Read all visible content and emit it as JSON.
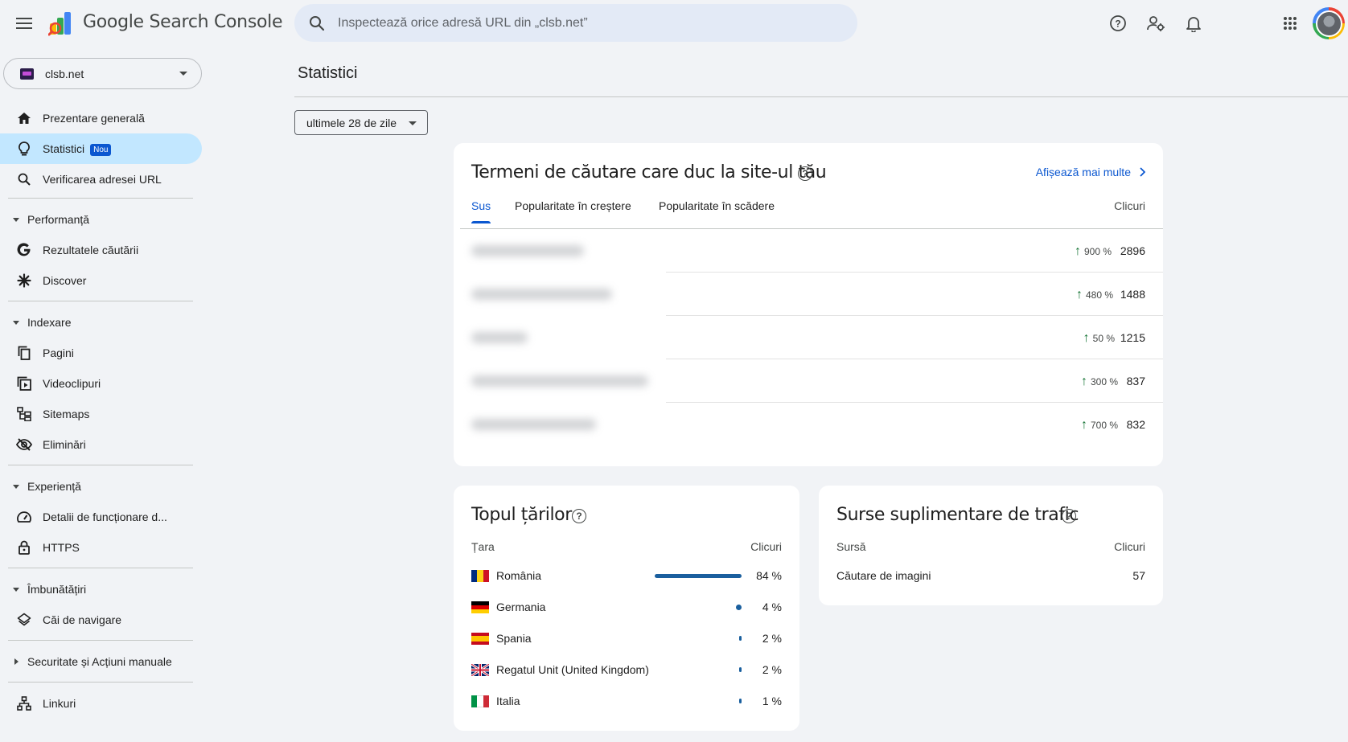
{
  "app": {
    "product_name": "Google Search Console",
    "search_placeholder": "Inspectează orice adresă URL din „clsb.net”",
    "property_name": "clsb.net"
  },
  "icons": {
    "menu": "hamburger-menu-icon",
    "search": "search-icon",
    "help": "help-circle-icon",
    "admin": "manage-users-icon",
    "notifications": "bell-icon",
    "apps": "apps-grid-icon"
  },
  "colors": {
    "accent": "#0b57d0",
    "active_nav_bg": "#c2e7ff",
    "trend_up": "#137333",
    "share_bar": "#1a5f9e",
    "page_bg": "#f1f3f6"
  },
  "sidebar": {
    "items": [
      {
        "label": "Prezentare generală",
        "icon": "home-icon"
      },
      {
        "label": "Statistici",
        "badge": "Nou",
        "icon": "lightbulb-icon",
        "active": true
      },
      {
        "label": "Verificarea adresei URL",
        "icon": "search-icon"
      }
    ],
    "sections": [
      {
        "label": "Performanță",
        "items": [
          {
            "label": "Rezultatele căutării",
            "icon": "google-g-icon"
          },
          {
            "label": "Discover",
            "icon": "asterisk-icon"
          }
        ]
      },
      {
        "label": "Indexare",
        "items": [
          {
            "label": "Pagini",
            "icon": "pages-icon"
          },
          {
            "label": "Videoclipuri",
            "icon": "video-icon"
          },
          {
            "label": "Sitemaps",
            "icon": "sitemap-icon"
          },
          {
            "label": "Eliminări",
            "icon": "eye-off-icon"
          }
        ]
      },
      {
        "label": "Experiență",
        "items": [
          {
            "label": "Detalii de funcționare d...",
            "icon": "gauge-icon"
          },
          {
            "label": "HTTPS",
            "icon": "lock-icon"
          }
        ]
      },
      {
        "label": "Îmbunătățiri",
        "items": [
          {
            "label": "Căi de navigare",
            "icon": "layers-icon"
          }
        ]
      },
      {
        "label": "Securitate și Acțiuni manuale",
        "collapsed": true,
        "items": []
      }
    ],
    "footer_items": [
      {
        "label": "Linkuri",
        "icon": "links-icon"
      }
    ]
  },
  "main": {
    "page_title": "Statistici",
    "date_filter": "ultimele 28 de zile",
    "search_terms": {
      "title": "Termeni de căutare care duc la site-ul tău",
      "show_more": "Afișează mai multe",
      "tabs": [
        "Sus",
        "Popularitate în creștere",
        "Popularitate în scădere"
      ],
      "active_tab": 0,
      "column_clicks": "Clicuri",
      "rows": [
        {
          "change": "900 %",
          "clicks": "2896",
          "trend": "up"
        },
        {
          "change": "480 %",
          "clicks": "1488",
          "trend": "up"
        },
        {
          "change": "50 %",
          "clicks": "1215",
          "trend": "up"
        },
        {
          "change": "300 %",
          "clicks": "837",
          "trend": "up"
        },
        {
          "change": "700 %",
          "clicks": "832",
          "trend": "up"
        }
      ]
    },
    "top_countries": {
      "title": "Topul țărilor",
      "col_country": "Țara",
      "col_clicks": "Clicuri",
      "rows": [
        {
          "name": "România",
          "pct": "84 %",
          "share": 0.84,
          "flag": "ro"
        },
        {
          "name": "Germania",
          "pct": "4 %",
          "share": 0.04,
          "flag": "de"
        },
        {
          "name": "Spania",
          "pct": "2 %",
          "share": 0.02,
          "flag": "es"
        },
        {
          "name": "Regatul Unit (United Kingdom)",
          "pct": "2 %",
          "share": 0.02,
          "flag": "gb"
        },
        {
          "name": "Italia",
          "pct": "1 %",
          "share": 0.01,
          "flag": "it"
        }
      ]
    },
    "traffic_sources": {
      "title": "Surse suplimentare de trafic",
      "col_source": "Sursă",
      "col_clicks": "Clicuri",
      "rows": [
        {
          "name": "Căutare de imagini",
          "clicks": "57"
        }
      ]
    }
  }
}
